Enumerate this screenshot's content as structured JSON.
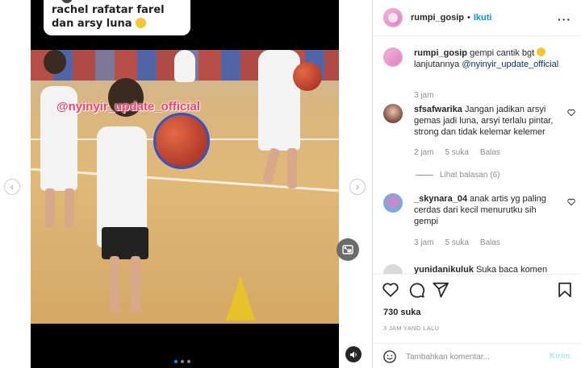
{
  "media": {
    "caption_text": "rachel rafatar farel dan arsy luna",
    "watermark": "@nyinyir_update_official",
    "carousel_count": 3,
    "carousel_active": 1
  },
  "post": {
    "username": "rumpi_gosip",
    "separator": "•",
    "follow_label": "Ikuti",
    "caption": {
      "username": "rumpi_gosip",
      "text": "gempi cantik bgt",
      "text2": "lanjutannya",
      "mention": "@nyinyir_update_official",
      "time": "3 jam"
    },
    "comments": [
      {
        "username": "sfsafwarika",
        "text": "Jangan jadikan arsyi gemas jadi luna, arsyi terlalu pintar, strong dan tidak kelemar kelemer",
        "time": "2 jam",
        "likes": "5 suka",
        "reply": "Balas",
        "view_replies": "Lihat balasan (6)"
      },
      {
        "username": "_skynara_04",
        "text": "anak artis yg paling cerdas dari kecil menurutku sih gempi",
        "time": "3 jam",
        "likes": "5 suka",
        "reply": "Balas"
      },
      {
        "username": "yunidanikuluk",
        "text": "Suka baca komen"
      }
    ],
    "like_count": "730 suka",
    "posted_ago": "3 JAM YANG LALU",
    "comment_placeholder": "Tambahkan komentar...",
    "post_label": "Kirim"
  },
  "icons": {
    "like": "heart-icon",
    "comment": "comment-icon",
    "share": "paper-plane-icon",
    "save": "bookmark-icon",
    "more": "more-dots-icon",
    "emoji": "smiley-icon"
  },
  "colors": {
    "accent": "#0095f6",
    "text": "#262626",
    "muted": "#8e8e8e",
    "watermark": "#ff3b6b",
    "ball_trim": "#2f56c9",
    "cone": "#e8c22a"
  }
}
